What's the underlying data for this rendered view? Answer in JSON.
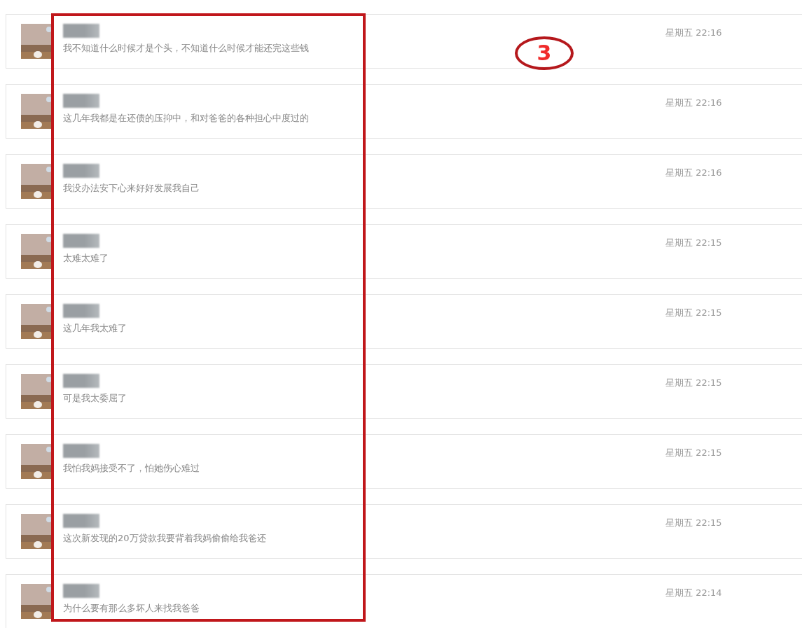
{
  "annotation": {
    "label": "3"
  },
  "messages": [
    {
      "text": "我不知道什么时候才是个头，不知道什么时候才能还完这些钱",
      "time": "星期五 22:16"
    },
    {
      "text": "这几年我都是在还债的压抑中，和对爸爸的各种担心中度过的",
      "time": "星期五 22:16"
    },
    {
      "text": "我没办法安下心来好好发展我自己",
      "time": "星期五 22:16"
    },
    {
      "text": "太难太难了",
      "time": "星期五 22:15"
    },
    {
      "text": "这几年我太难了",
      "time": "星期五 22:15"
    },
    {
      "text": "可是我太委屈了",
      "time": "星期五 22:15"
    },
    {
      "text": "我怕我妈接受不了，怕她伤心难过",
      "time": "星期五 22:15"
    },
    {
      "text": "这次新发现的20万贷款我要背着我妈偷偷给我爸还",
      "time": "星期五 22:15"
    },
    {
      "text": "为什么要有那么多坏人来找我爸爸",
      "time": "星期五 22:14"
    }
  ]
}
